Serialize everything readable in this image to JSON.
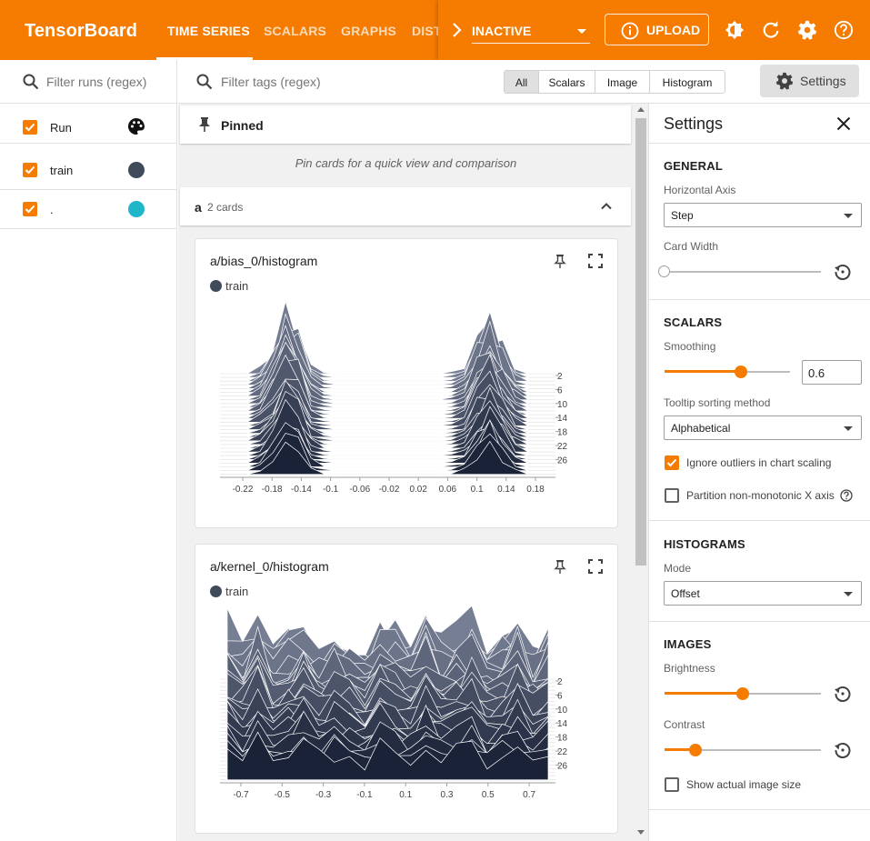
{
  "app": {
    "title": "TensorBoard"
  },
  "nav": {
    "tabs": [
      {
        "label": "TIME SERIES",
        "active": true
      },
      {
        "label": "SCALARS"
      },
      {
        "label": "GRAPHS"
      },
      {
        "label": "DIST"
      }
    ],
    "plugin_select": "INACTIVE",
    "upload_label": "UPLOAD",
    "icons": [
      "brightness-icon",
      "refresh-icon",
      "settings-gear-icon",
      "help-icon"
    ]
  },
  "runs": {
    "filter_placeholder": "Filter runs (regex)",
    "header_label": "Run",
    "items": [
      {
        "label": "train",
        "color": "#3f4a5a",
        "checked": true
      },
      {
        "label": ".",
        "color": "#1fb6c9",
        "checked": true
      }
    ]
  },
  "main": {
    "tag_filter_placeholder": "Filter tags (regex)",
    "type_filters": [
      "All",
      "Scalars",
      "Image",
      "Histogram"
    ],
    "type_filter_selected": "All",
    "settings_button": "Settings",
    "pinned": {
      "title": "Pinned",
      "empty_message": "Pin cards for a quick view and comparison"
    },
    "group": {
      "name": "a",
      "count_label": "2 cards"
    },
    "cards": [
      {
        "title": "a/bias_0/histogram",
        "legend": "train",
        "x_ticks": [
          "-0.22",
          "-0.18",
          "-0.14",
          "-0.1",
          "-0.06",
          "-0.02",
          "0.02",
          "0.06",
          "0.1",
          "0.14",
          "0.18"
        ],
        "y_ticks": [
          "2",
          "6",
          "10",
          "14",
          "18",
          "22",
          "26"
        ]
      },
      {
        "title": "a/kernel_0/histogram",
        "legend": "train",
        "x_ticks": [
          "-0.7",
          "-0.5",
          "-0.3",
          "-0.1",
          "0.1",
          "0.3",
          "0.5",
          "0.7"
        ],
        "y_ticks": [
          "2",
          "6",
          "10",
          "14",
          "18",
          "22",
          "26"
        ]
      }
    ]
  },
  "settings": {
    "title": "Settings",
    "general": {
      "heading": "GENERAL",
      "horizontal_axis_label": "Horizontal Axis",
      "horizontal_axis_value": "Step",
      "card_width_label": "Card Width",
      "card_width_value": 0
    },
    "scalars": {
      "heading": "SCALARS",
      "smoothing_label": "Smoothing",
      "smoothing_value": "0.6",
      "tooltip_label": "Tooltip sorting method",
      "tooltip_value": "Alphabetical",
      "ignore_outliers_label": "Ignore outliers in chart scaling",
      "ignore_outliers": true,
      "partition_label": "Partition non-monotonic X axis",
      "partition": false
    },
    "histograms": {
      "heading": "HISTOGRAMS",
      "mode_label": "Mode",
      "mode_value": "Offset"
    },
    "images": {
      "heading": "IMAGES",
      "brightness_label": "Brightness",
      "brightness_value": 0.5,
      "contrast_label": "Contrast",
      "contrast_value": 0.2,
      "actual_size_label": "Show actual image size",
      "actual_size": false
    }
  },
  "colors": {
    "accent": "#f57c00",
    "train": "#3f4a5a",
    "dot_run": "#1fb6c9"
  }
}
